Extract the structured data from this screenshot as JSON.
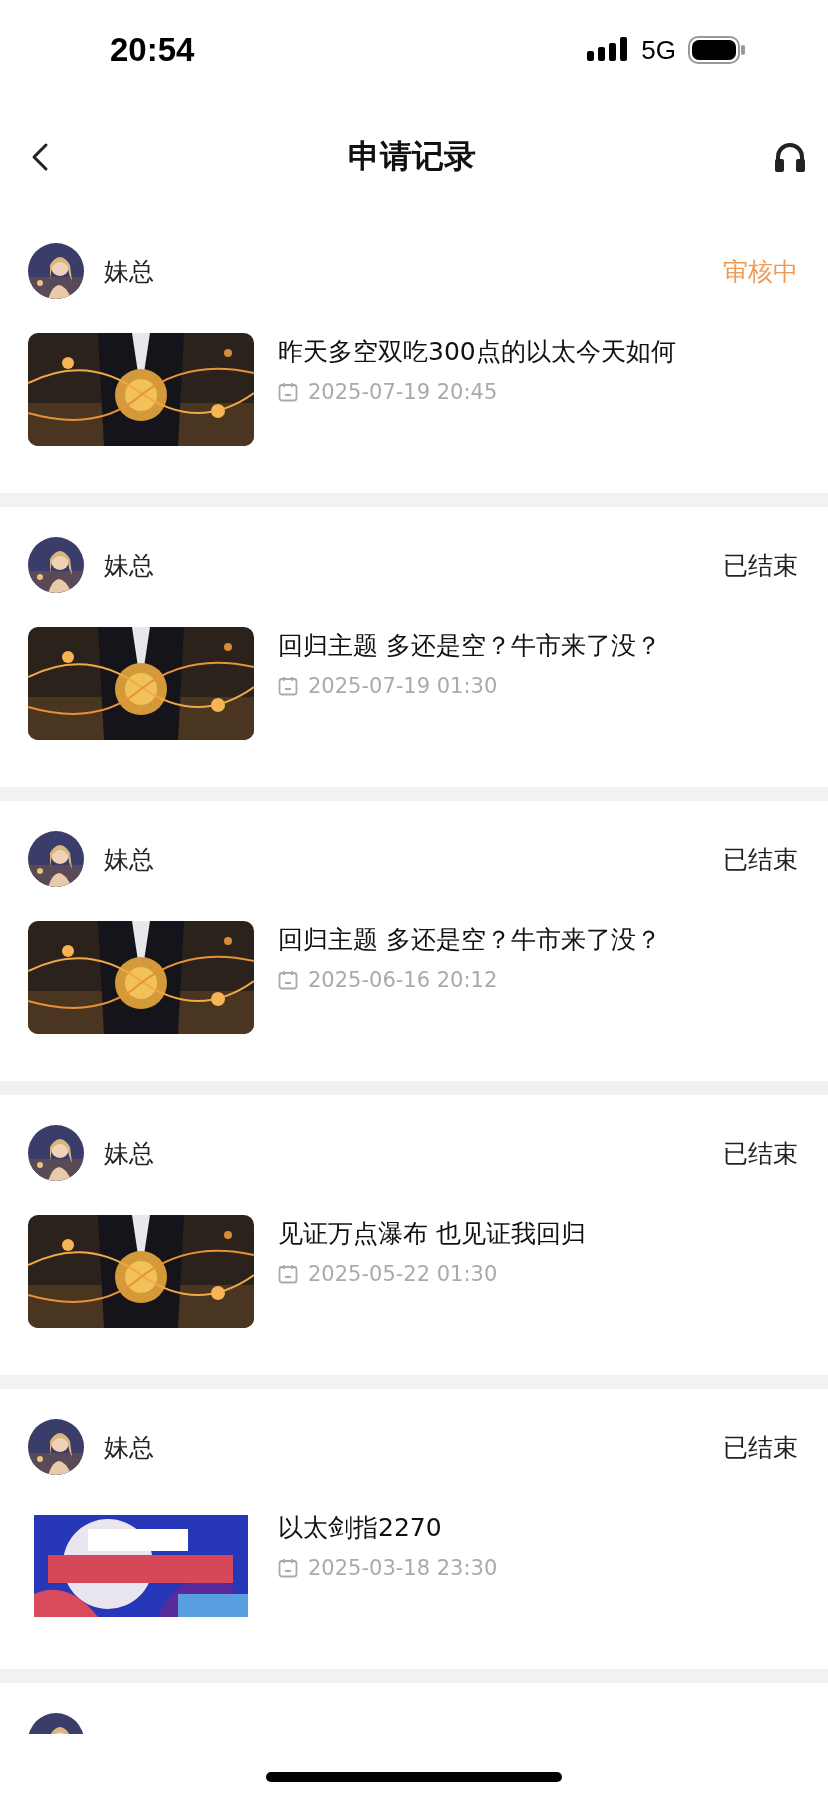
{
  "status_bar": {
    "time": "20:54",
    "network": "5G"
  },
  "nav": {
    "title": "申请记录"
  },
  "records": [
    {
      "user": "妹总",
      "status": {
        "text": "审核中",
        "color": "#ee9a55"
      },
      "title": "昨天多空双吃300点的以太今天如何",
      "date": "2025-07-19 20:45"
    },
    {
      "user": "妹总",
      "status": {
        "text": "已结束",
        "color": "#222222"
      },
      "title": "回归主题 多还是空？牛市来了没？",
      "date": "2025-07-19 01:30"
    },
    {
      "user": "妹总",
      "status": {
        "text": "已结束",
        "color": "#222222"
      },
      "title": "回归主题 多还是空？牛市来了没？",
      "date": "2025-06-16 20:12"
    },
    {
      "user": "妹总",
      "status": {
        "text": "已结束",
        "color": "#222222"
      },
      "title": "见证万点瀑布 也见证我回归",
      "date": "2025-05-22 01:30"
    },
    {
      "user": "妹总",
      "status": {
        "text": "已结束",
        "color": "#222222"
      },
      "thumbnail": {
        "kind": "banner"
      },
      "title": "以太剑指2270",
      "date": "2025-03-18 23:30"
    }
  ]
}
